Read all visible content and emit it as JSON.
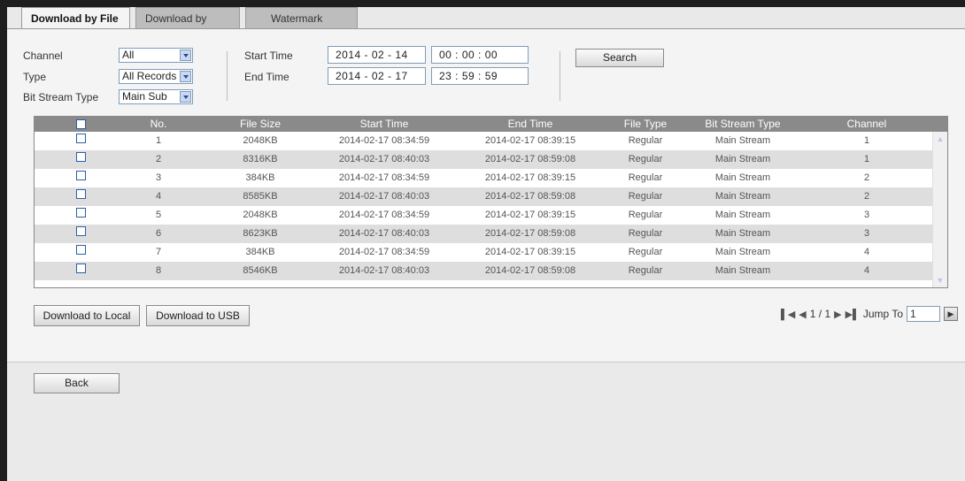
{
  "tabs": [
    "Download by File",
    "Download by Time",
    "Watermark"
  ],
  "filters": {
    "channel_label": "Channel",
    "channel_value": "All",
    "type_label": "Type",
    "type_value": "All Records",
    "bitstream_label": "Bit Stream Type",
    "bitstream_value": "Main Sub",
    "start_label": "Start Time",
    "start_date": "2014 -  02  -  14",
    "start_time": "00  :  00  :  00",
    "end_label": "End Time",
    "end_date": "2014 -  02  -  17",
    "end_time": "23  :  59  :  59",
    "search_label": "Search"
  },
  "table": {
    "columns": [
      "No.",
      "File Size",
      "Start Time",
      "End Time",
      "File Type",
      "Bit Stream Type",
      "Channel"
    ],
    "rows": [
      {
        "no": "1",
        "size": "2048KB",
        "start": "2014-02-17 08:34:59",
        "end": "2014-02-17 08:39:15",
        "type": "Regular",
        "stream": "Main Stream",
        "channel": "1"
      },
      {
        "no": "2",
        "size": "8316KB",
        "start": "2014-02-17 08:40:03",
        "end": "2014-02-17 08:59:08",
        "type": "Regular",
        "stream": "Main Stream",
        "channel": "1"
      },
      {
        "no": "3",
        "size": "384KB",
        "start": "2014-02-17 08:34:59",
        "end": "2014-02-17 08:39:15",
        "type": "Regular",
        "stream": "Main Stream",
        "channel": "2"
      },
      {
        "no": "4",
        "size": "8585KB",
        "start": "2014-02-17 08:40:03",
        "end": "2014-02-17 08:59:08",
        "type": "Regular",
        "stream": "Main Stream",
        "channel": "2"
      },
      {
        "no": "5",
        "size": "2048KB",
        "start": "2014-02-17 08:34:59",
        "end": "2014-02-17 08:39:15",
        "type": "Regular",
        "stream": "Main Stream",
        "channel": "3"
      },
      {
        "no": "6",
        "size": "8623KB",
        "start": "2014-02-17 08:40:03",
        "end": "2014-02-17 08:59:08",
        "type": "Regular",
        "stream": "Main Stream",
        "channel": "3"
      },
      {
        "no": "7",
        "size": "384KB",
        "start": "2014-02-17 08:34:59",
        "end": "2014-02-17 08:39:15",
        "type": "Regular",
        "stream": "Main Stream",
        "channel": "4"
      },
      {
        "no": "8",
        "size": "8546KB",
        "start": "2014-02-17 08:40:03",
        "end": "2014-02-17 08:59:08",
        "type": "Regular",
        "stream": "Main Stream",
        "channel": "4"
      }
    ]
  },
  "actions": {
    "download_local": "Download to Local",
    "download_usb": "Download to USB",
    "back": "Back"
  },
  "pager": {
    "page": "1 / 1",
    "jump_label": "Jump To",
    "jump_value": "1"
  }
}
